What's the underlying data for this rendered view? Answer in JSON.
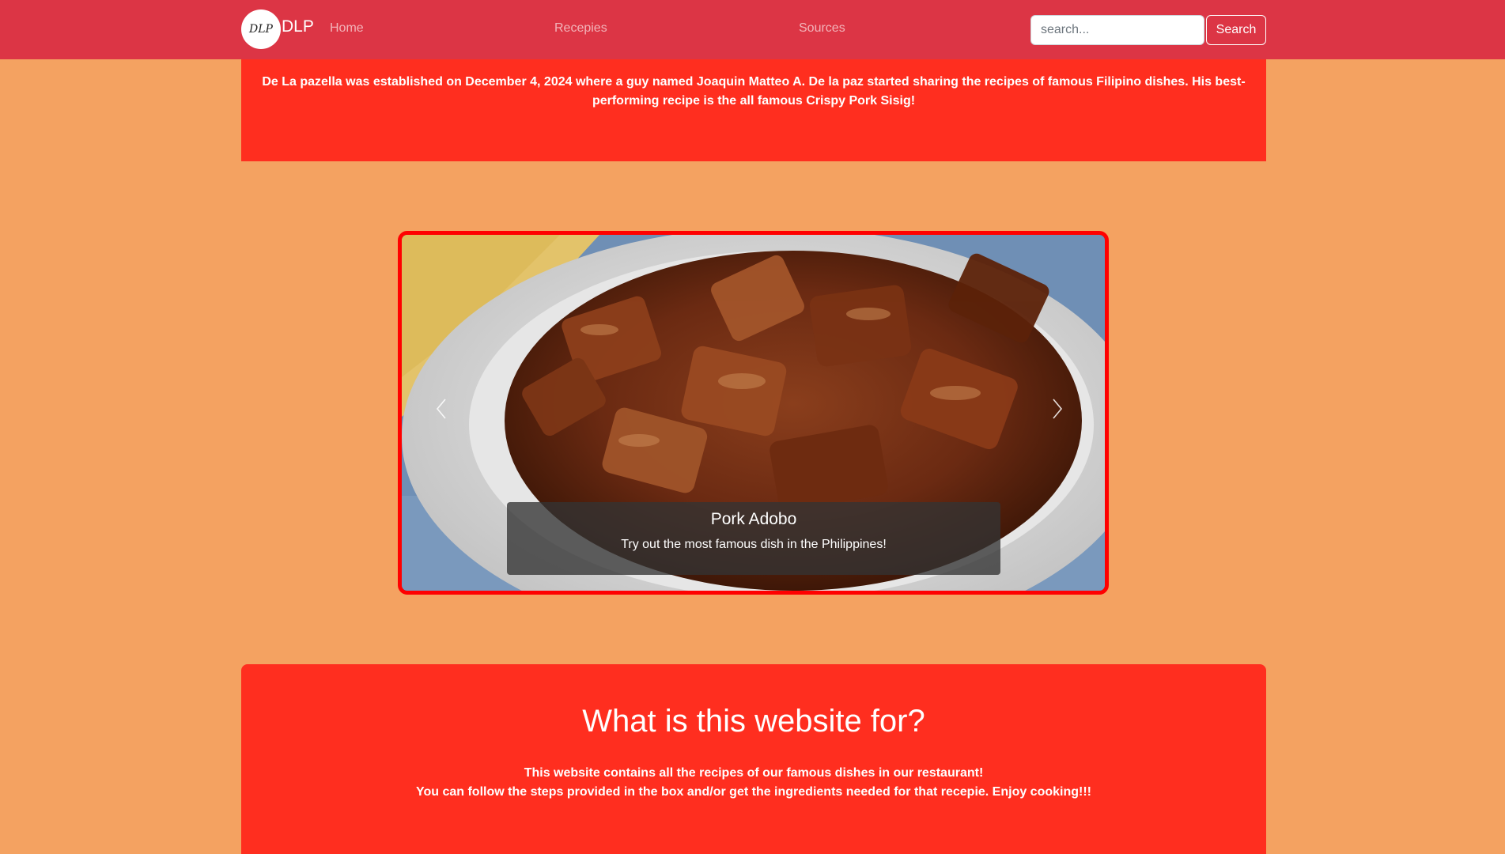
{
  "header": {
    "logo_text": "DLP",
    "brand_name": "DLP",
    "nav": [
      "Home",
      "Recepies",
      "Sources"
    ],
    "search_placeholder": "search...",
    "search_button": "Search"
  },
  "intro": {
    "text": "De La pazella was established on December 4, 2024 where a guy named Joaquin Matteo A. De la paz started sharing the recipes of famous Filipino dishes. His best-performing recipe is the all famous Crispy Pork Sisig!"
  },
  "carousel": {
    "caption_title": "Pork Adobo",
    "caption_text": "Try out the most famous dish in the Philippines!",
    "prev_icon": "chevron-left-icon",
    "next_icon": "chevron-right-icon"
  },
  "about": {
    "title": "What is this website for?",
    "line1": "This website contains all the recipes of our famous dishes in our restaurant!",
    "line2": "You can follow the steps provided in the box and/or get the ingredients needed for that recepie. Enjoy cooking!!!"
  },
  "colors": {
    "page_bg": "#f4a261",
    "navbar": "#dc3545",
    "banner": "#ff2e1f",
    "carousel_border": "#ff0000"
  }
}
